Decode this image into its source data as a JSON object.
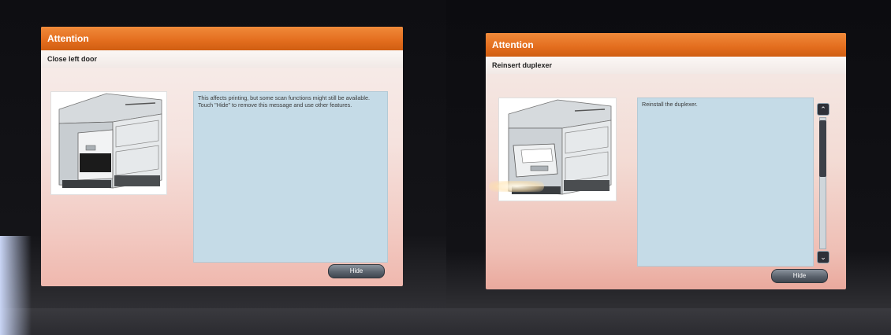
{
  "panels": [
    {
      "header": "Attention",
      "message_title": "Close left door",
      "illustration": "printer-left-door-open",
      "body_text": "This affects printing, but some scan functions might still be available. Touch \"Hide\" to remove this message and use other features.",
      "button_label": "Hide"
    },
    {
      "header": "Attention",
      "message_title": "Reinsert duplexer",
      "illustration": "printer-duplexer-removed",
      "body_text": "Reinstall the duplexer.",
      "button_label": "Hide",
      "scroll_up_icon": "chevron-up-icon",
      "scroll_down_icon": "chevron-down-icon"
    }
  ],
  "colors": {
    "title_bar": "#e36d1e",
    "text_panel": "#c5dbe7",
    "button": "#5b636d"
  }
}
